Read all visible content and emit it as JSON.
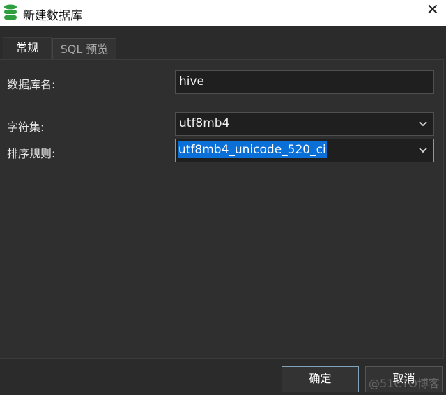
{
  "window": {
    "title": "新建数据库",
    "icon": "database-icon",
    "close": "✕"
  },
  "tabs": [
    {
      "label": "常规",
      "active": true
    },
    {
      "label": "SQL 预览",
      "active": false
    }
  ],
  "form": {
    "db_name": {
      "label": "数据库名:",
      "value": "hive"
    },
    "charset": {
      "label": "字符集:",
      "value": "utf8mb4"
    },
    "collation": {
      "label": "排序规则:",
      "value": "utf8mb4_unicode_520_ci"
    }
  },
  "buttons": {
    "ok": "确定",
    "cancel": "取消"
  },
  "watermark": "@51CTO博客",
  "colors": {
    "accent": "#0a6fd6",
    "icon_green": "#2e9e3e"
  }
}
